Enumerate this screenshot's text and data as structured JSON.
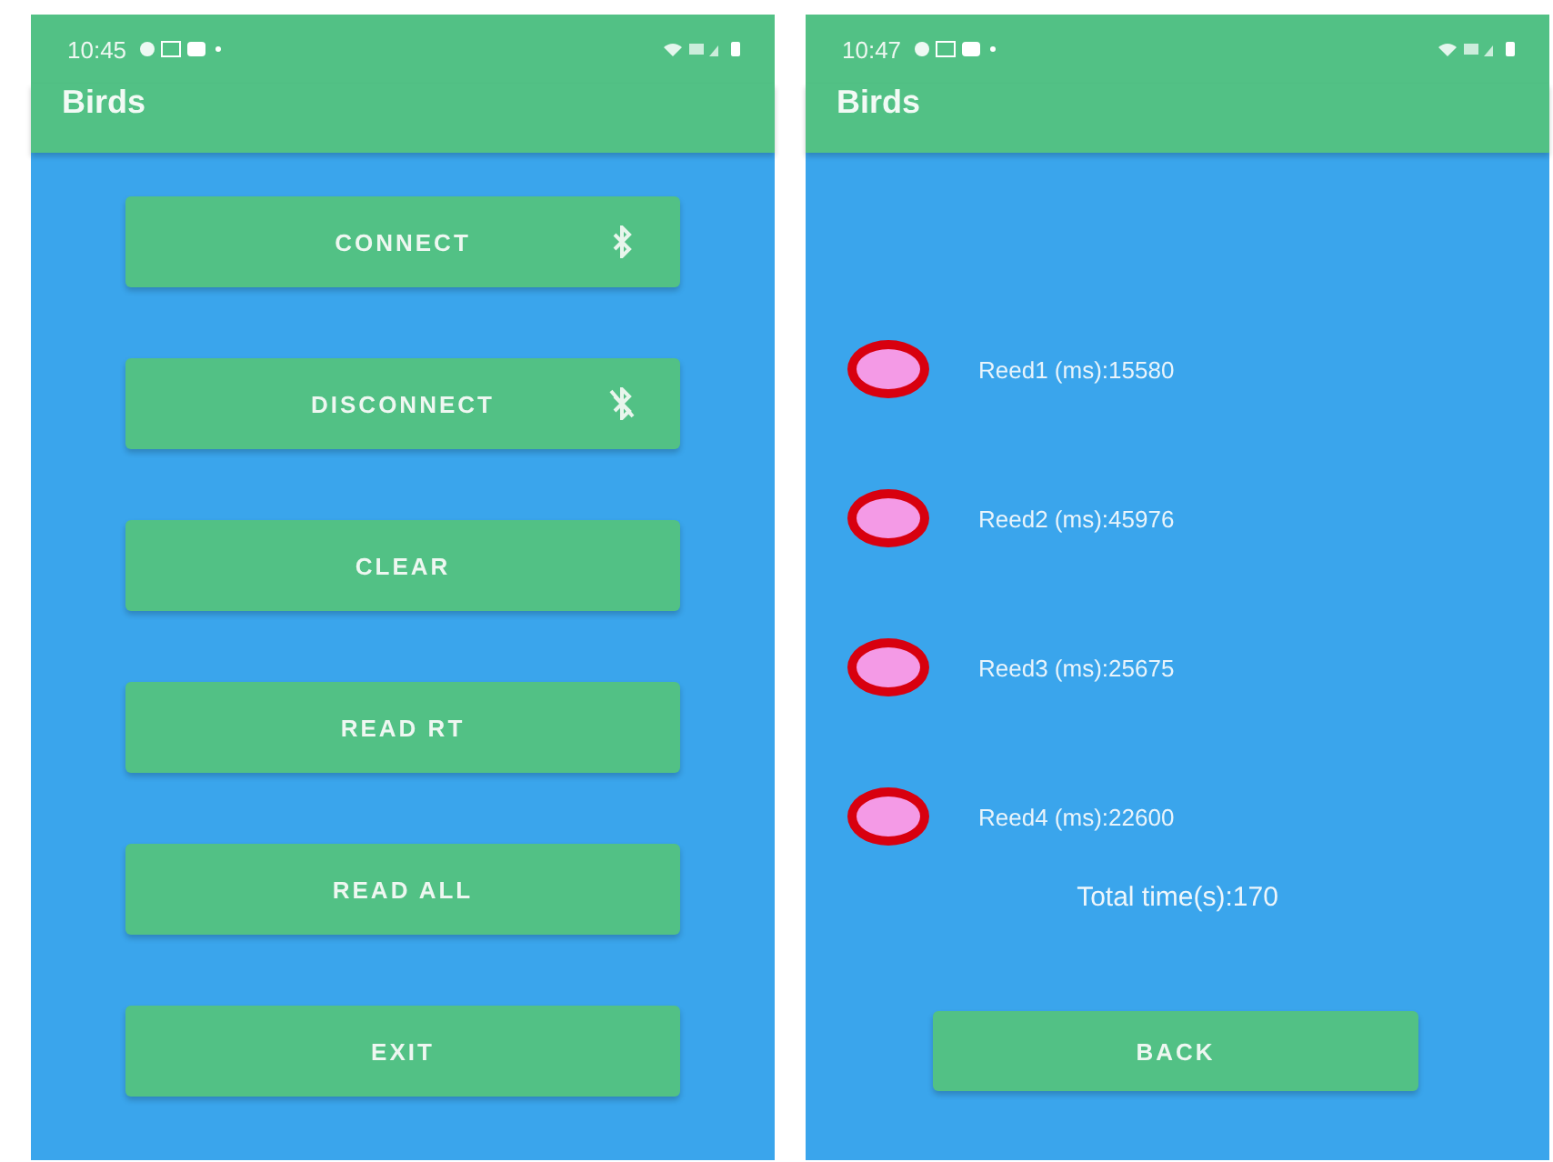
{
  "screens": [
    {
      "status_bar": {
        "time": "10:45"
      },
      "title": "Birds",
      "buttons": [
        {
          "label": "CONNECT",
          "kind": "bluetooth"
        },
        {
          "label": "DISCONNECT",
          "kind": "bluetooth-off"
        },
        {
          "label": "CLEAR",
          "kind": "plain"
        },
        {
          "label": "READ RT",
          "kind": "plain"
        },
        {
          "label": "READ ALL",
          "kind": "plain"
        },
        {
          "label": "EXIT",
          "kind": "plain"
        }
      ]
    },
    {
      "status_bar": {
        "time": "10:47"
      },
      "title": "Birds",
      "reeds": [
        {
          "label": "Reed1 (ms):15580"
        },
        {
          "label": "Reed2 (ms):45976"
        },
        {
          "label": "Reed3 (ms):25675"
        },
        {
          "label": "Reed4 (ms):22600"
        }
      ],
      "total": "Total time(s):170",
      "buttons": [
        {
          "label": "BACK",
          "kind": "plain"
        }
      ]
    }
  ]
}
